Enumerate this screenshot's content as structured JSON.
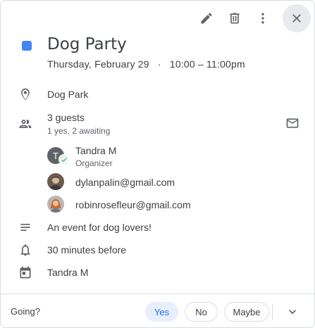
{
  "event": {
    "title": "Dog Party",
    "date": "Thursday, February 29",
    "separator": "·",
    "time": "10:00 – 11:00pm",
    "color": "#4285f4"
  },
  "toolbar": {
    "edit_icon": "pencil-icon",
    "delete_icon": "trash-icon",
    "more_icon": "more-vert-icon",
    "close_icon": "close-icon"
  },
  "location": {
    "text": "Dog Park"
  },
  "guests": {
    "count_label": "3 guests",
    "summary": "1 yes, 2 awaiting",
    "list": [
      {
        "name": "Tandra M",
        "role": "Organizer",
        "initial": "T"
      },
      {
        "name": "dylanpalin@gmail.com"
      },
      {
        "name": "robinrosefleur@gmail.com"
      }
    ]
  },
  "description": {
    "text": "An event for dog lovers!"
  },
  "reminder": {
    "text": "30 minutes before"
  },
  "calendar": {
    "text": "Tandra M"
  },
  "rsvp": {
    "prompt": "Going?",
    "yes": "Yes",
    "no": "No",
    "maybe": "Maybe",
    "selected": "Yes"
  }
}
